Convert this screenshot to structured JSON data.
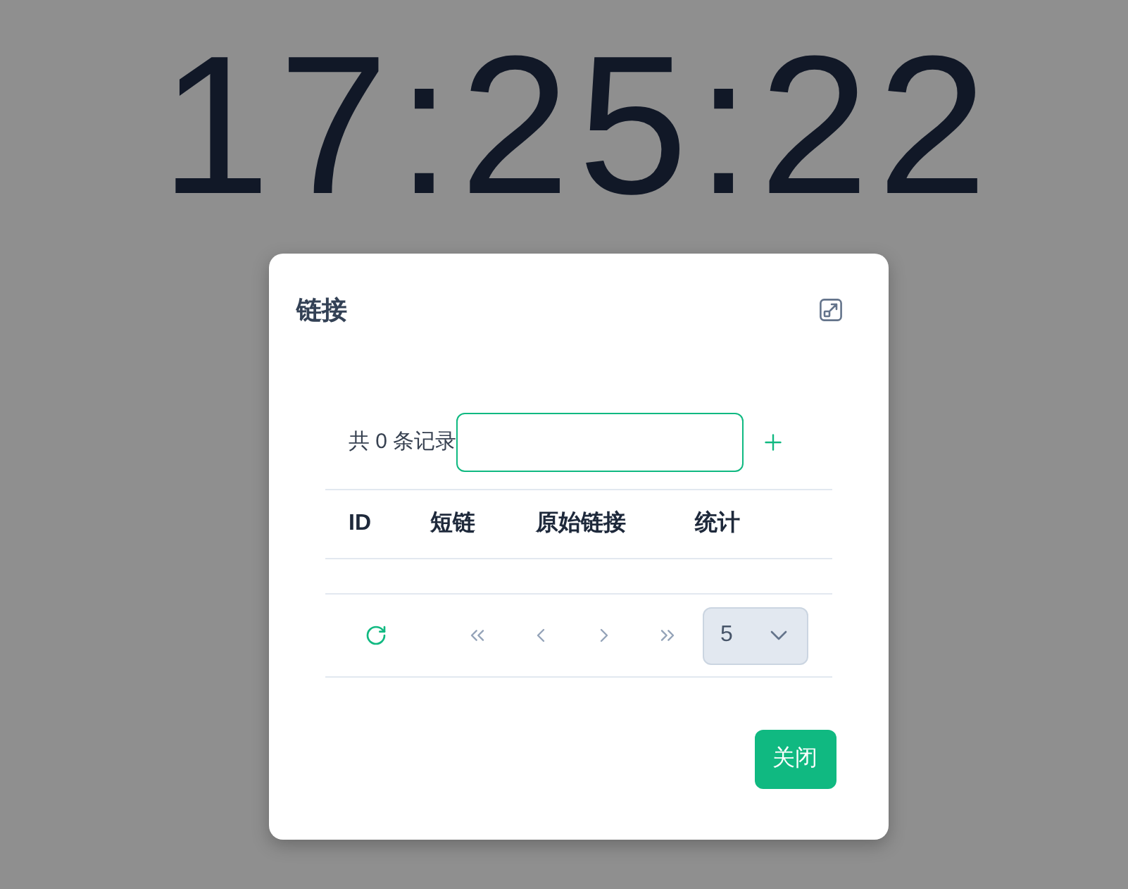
{
  "clock": {
    "time": "17:25:22"
  },
  "dialog": {
    "title": "链接",
    "record_count": "共 0 条记录",
    "table": {
      "columns": [
        "ID",
        "短链",
        "原始链接",
        "统计"
      ]
    },
    "pager": [
      {
        "kind": "first",
        "disabled": true
      },
      {
        "kind": "prev",
        "disabled": true
      },
      {
        "kind": "next",
        "disabled": true
      },
      {
        "kind": "last",
        "disabled": true
      }
    ],
    "page_size": "5",
    "buttons": [
      {
        "label": "关闭"
      }
    ]
  }
}
